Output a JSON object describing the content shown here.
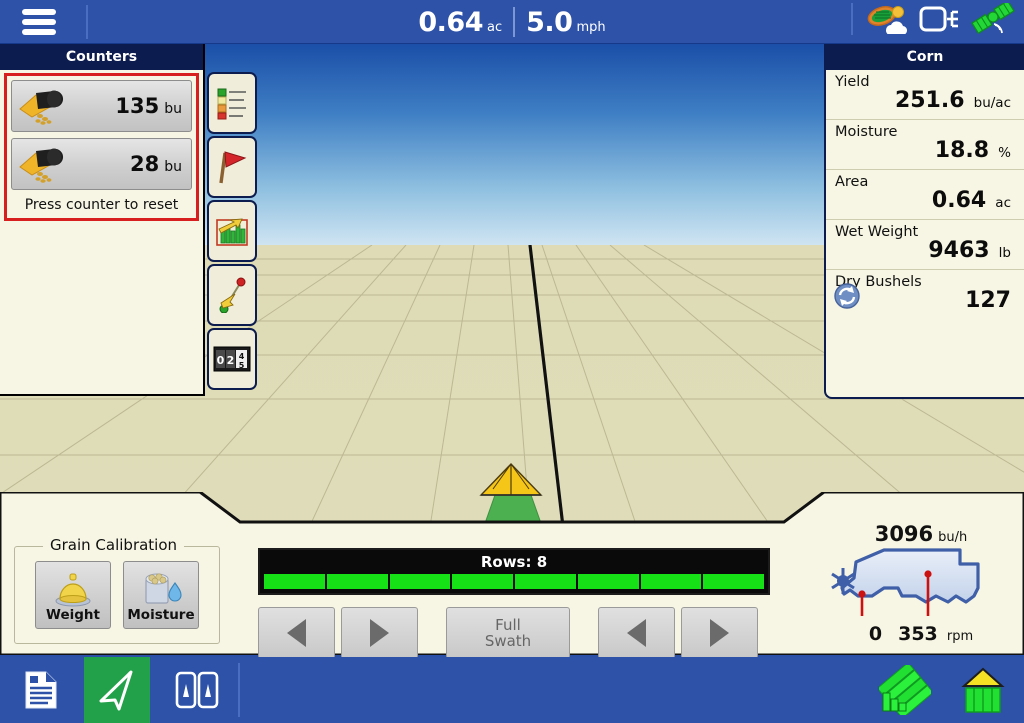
{
  "topbar": {
    "menu_icon": "hamburger-menu-icon",
    "area": {
      "value": "0.64",
      "unit": "ac"
    },
    "speed": {
      "value": "5.0",
      "unit": "mph"
    },
    "status_icons": [
      {
        "name": "weather-satellite-icon"
      },
      {
        "name": "display-connection-icon"
      },
      {
        "name": "gps-signal-icon"
      }
    ]
  },
  "counters_panel": {
    "title": "Counters",
    "rows": [
      {
        "icon": "grain-auger-icon",
        "value": "135",
        "unit": "bu"
      },
      {
        "icon": "grain-auger-icon",
        "value": "28",
        "unit": "bu"
      }
    ],
    "hint": "Press counter to reset"
  },
  "vertical_toolbar": {
    "items": [
      {
        "name": "legend-icon",
        "label": "Legend"
      },
      {
        "name": "flag-marker-icon",
        "label": "Flag"
      },
      {
        "name": "yield-chart-icon",
        "label": "Yield Map"
      },
      {
        "name": "ab-line-icon",
        "label": "AB Line"
      },
      {
        "name": "odometer-icon",
        "label": "Counter"
      }
    ]
  },
  "crop_panel": {
    "title": "Corn",
    "stats": [
      {
        "label": "Yield",
        "value": "251.6",
        "unit": "bu/ac",
        "icon": null
      },
      {
        "label": "Moisture",
        "value": "18.8",
        "unit": "%",
        "icon": null
      },
      {
        "label": "Area",
        "value": "0.64",
        "unit": "ac",
        "icon": null
      },
      {
        "label": "Wet Weight",
        "value": "9463",
        "unit": "lb",
        "icon": null
      },
      {
        "label": "Dry Bushels",
        "value": "127",
        "unit": "",
        "icon": "refresh-icon"
      }
    ]
  },
  "map_view": {
    "vehicle_icon": "combine-vehicle-icon",
    "guidance_line": "ab-guidance-line",
    "sky_color": "#2f6ebd",
    "ground_color": "#dfdcb8"
  },
  "grain_calibration": {
    "title": "Grain Calibration",
    "buttons": [
      {
        "label": "Weight",
        "icon": "weight-scale-icon"
      },
      {
        "label": "Moisture",
        "icon": "moisture-bucket-icon"
      }
    ]
  },
  "swath_control": {
    "rows_label": "Rows: 8",
    "row_count": 8,
    "row_active_color": "#16e016",
    "left_arrow_icon": "arrow-left-icon",
    "right_arrow_icon": "arrow-right-icon",
    "full_swath_line1": "Full",
    "full_swath_line2": "Swath"
  },
  "rpm_widget": {
    "flow": {
      "value": "3096",
      "unit": "bu/h"
    },
    "icon": "combine-outline-icon",
    "fan_icon": "fan-icon",
    "readings": [
      {
        "value": "0",
        "unit": ""
      },
      {
        "value": "353",
        "unit": "rpm"
      }
    ]
  },
  "navbar": {
    "items": [
      {
        "name": "nav-reports-icon",
        "label": "Reports",
        "active": false
      },
      {
        "name": "nav-map-guidance-icon",
        "label": "Map",
        "active": true
      },
      {
        "name": "nav-split-view-icon",
        "label": "Split View",
        "active": false
      }
    ],
    "right_items": [
      {
        "name": "nav-yield-map-icon",
        "label": "Yield Map"
      },
      {
        "name": "nav-grain-bin-icon",
        "label": "Grain Bin"
      }
    ],
    "active_color": "#22a04a",
    "bar_color": "#2d52a8"
  }
}
